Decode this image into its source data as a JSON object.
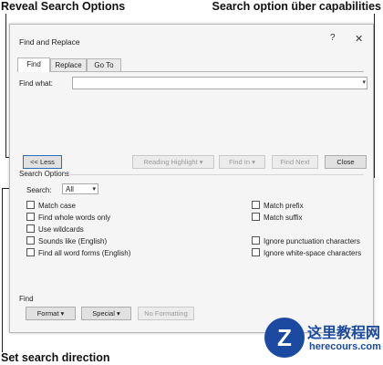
{
  "annotations": {
    "reveal_search_options": "Reveal Search Options",
    "uber_capabilities": "Search option über capabilities",
    "set_search_direction": "Set search direction"
  },
  "dialog": {
    "title": "Find and Replace",
    "help_glyph": "?",
    "close_glyph": "✕"
  },
  "tabs": [
    {
      "label": "Find",
      "active": true
    },
    {
      "label": "Replace",
      "active": false
    },
    {
      "label": "Go To",
      "active": false
    }
  ],
  "find_what": {
    "label": "Find what:",
    "value": "",
    "dropdown_glyph": "▾"
  },
  "buttons": {
    "less": "<< Less",
    "reading_highlight": "Reading Highlight ▾",
    "find_in": "Find In ▾",
    "find_next": "Find Next",
    "close": "Close"
  },
  "search_options": {
    "section_label": "Search Options",
    "search_label": "Search:",
    "search_value": "All",
    "search_dropdown_glyph": "▾",
    "left_options": [
      {
        "label": "Match case",
        "checked": false
      },
      {
        "label": "Find whole words only",
        "checked": false
      },
      {
        "label": "Use wildcards",
        "checked": false
      },
      {
        "label": "Sounds like (English)",
        "checked": false
      },
      {
        "label": "Find all word forms (English)",
        "checked": false
      }
    ],
    "right_options": [
      {
        "label": "Match prefix",
        "checked": false
      },
      {
        "label": "Match suffix",
        "checked": false
      },
      {
        "label": "Ignore punctuation characters",
        "checked": false
      },
      {
        "label": "Ignore white-space characters",
        "checked": false
      }
    ]
  },
  "find_section": {
    "label": "Find",
    "format": "Format ▾",
    "special": "Special ▾",
    "no_formatting": "No Formatting"
  },
  "watermark": {
    "logo_letter": "Z",
    "site_name_cn": "这里教程网",
    "site_domain": "herecours.com"
  },
  "colors": {
    "focus_border": "#2d6bbd",
    "watermark_blue": "#1b4aa0"
  }
}
